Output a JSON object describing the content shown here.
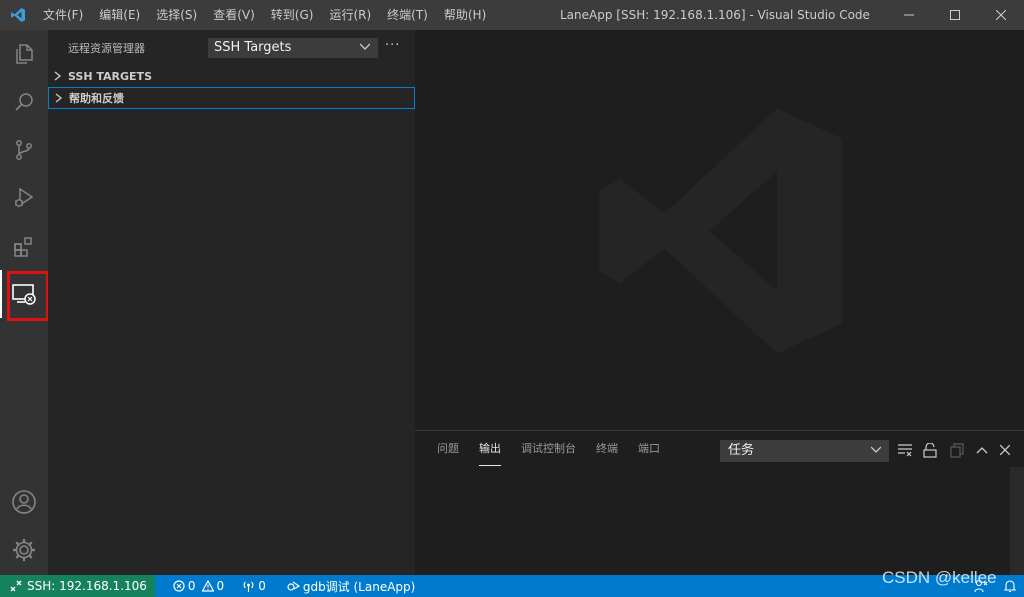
{
  "titlebar": {
    "menu": [
      "文件(F)",
      "编辑(E)",
      "选择(S)",
      "查看(V)",
      "转到(G)",
      "运行(R)",
      "终端(T)",
      "帮助(H)"
    ],
    "window_title": "LaneApp [SSH: 192.168.1.106] - Visual Studio Code",
    "icons": [
      "vscode-logo",
      "minimize-icon",
      "maximize-icon",
      "close-icon"
    ]
  },
  "activitybar": {
    "items": [
      "explorer-icon",
      "search-icon",
      "source-control-icon",
      "run-debug-icon",
      "extensions-icon",
      "remote-explorer-icon"
    ],
    "active": "remote-explorer-icon",
    "bottom": [
      "account-icon",
      "manage-gear-icon"
    ]
  },
  "sidebar": {
    "title": "远程资源管理器",
    "target_select": "SSH Targets",
    "more": "···",
    "sections": [
      {
        "label": "SSH TARGETS",
        "expanded": false
      },
      {
        "label": "帮助和反馈",
        "expanded": false
      }
    ]
  },
  "panel": {
    "tabs": [
      "问题",
      "输出",
      "调试控制台",
      "终端",
      "端口"
    ],
    "active_tab": "输出",
    "output_select": "任务"
  },
  "statusbar": {
    "remote": "SSH: 192.168.1.106",
    "errors": "0",
    "warnings": "0",
    "ports": "0",
    "debug": "gdb调试 (LaneApp)"
  },
  "colors": {
    "statusbar": "#007acc",
    "remote": "#16825d",
    "highlight": "#e01010",
    "focus": "#007fd4"
  },
  "watermark": "CSDN @kellee"
}
